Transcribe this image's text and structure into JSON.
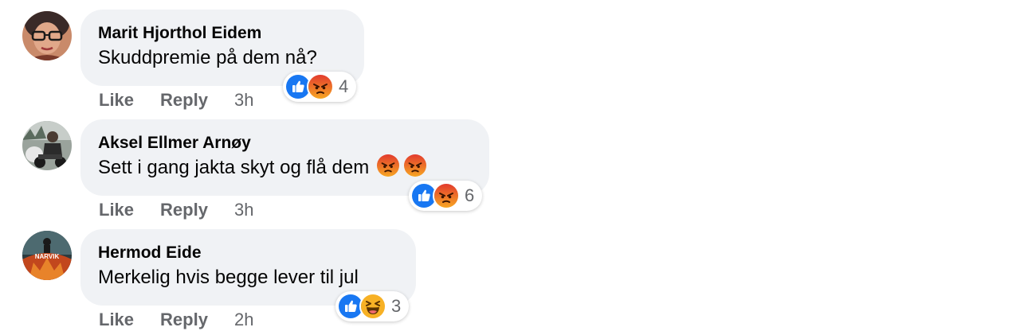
{
  "comments": [
    {
      "author": "Marit Hjorthol Eidem",
      "text": "Skuddpremie på dem nå?",
      "avatar": "avatar-woman-glasses",
      "reactions": [
        "like-icon",
        "angry-icon"
      ],
      "reaction_count": "4",
      "like_label": "Like",
      "reply_label": "Reply",
      "time": "3h"
    },
    {
      "author": "Aksel Ellmer Arnøy",
      "text": "Sett i gang jakta skyt og flå dem",
      "inline_emojis": [
        "angry-icon",
        "angry-icon"
      ],
      "avatar": "avatar-man-motorcycle",
      "reactions": [
        "like-icon",
        "angry-icon"
      ],
      "reaction_count": "6",
      "like_label": "Like",
      "reply_label": "Reply",
      "time": "3h"
    },
    {
      "author": "Hermod Eide",
      "text": "Merkelig hvis begge lever til jul",
      "avatar": "avatar-poster",
      "avatar_text": "NARVIK",
      "reactions": [
        "like-icon",
        "haha-icon"
      ],
      "reaction_count": "3",
      "like_label": "Like",
      "reply_label": "Reply",
      "time": "2h"
    }
  ],
  "colors": {
    "bubble": "#f0f2f5",
    "like_blue": "#1877f2",
    "angry_orange": "#e9710f",
    "haha_yellow": "#f7b125",
    "meta_gray": "#65676b"
  }
}
